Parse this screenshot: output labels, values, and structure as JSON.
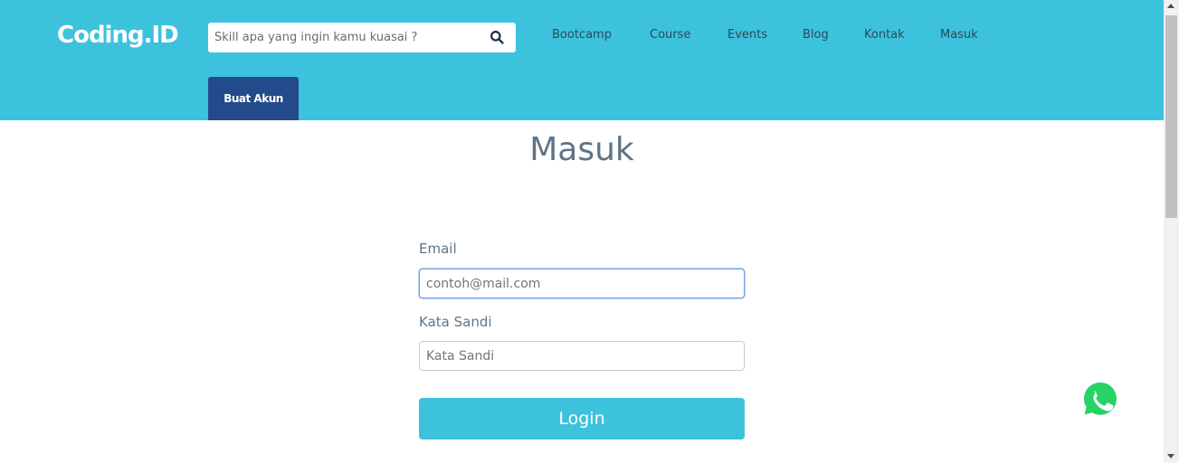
{
  "header": {
    "logo": "Coding.ID",
    "search_placeholder": "Skill apa yang ingin kamu kuasai ?",
    "nav": [
      "Bootcamp",
      "Course",
      "Events",
      "Blog",
      "Kontak",
      "Masuk"
    ],
    "signup_label": "Buat Akun"
  },
  "main": {
    "title": "Masuk",
    "email_label": "Email",
    "email_placeholder": "contoh@mail.com",
    "password_label": "Kata Sandi",
    "password_placeholder": "Kata Sandi",
    "login_label": "Login"
  },
  "icons": {
    "search": "search-icon",
    "whatsapp": "whatsapp-icon"
  },
  "colors": {
    "header": "#3dc2dd",
    "signup_button": "#234a8a",
    "login_button": "#3dc2dd",
    "whatsapp": "#25d366"
  }
}
